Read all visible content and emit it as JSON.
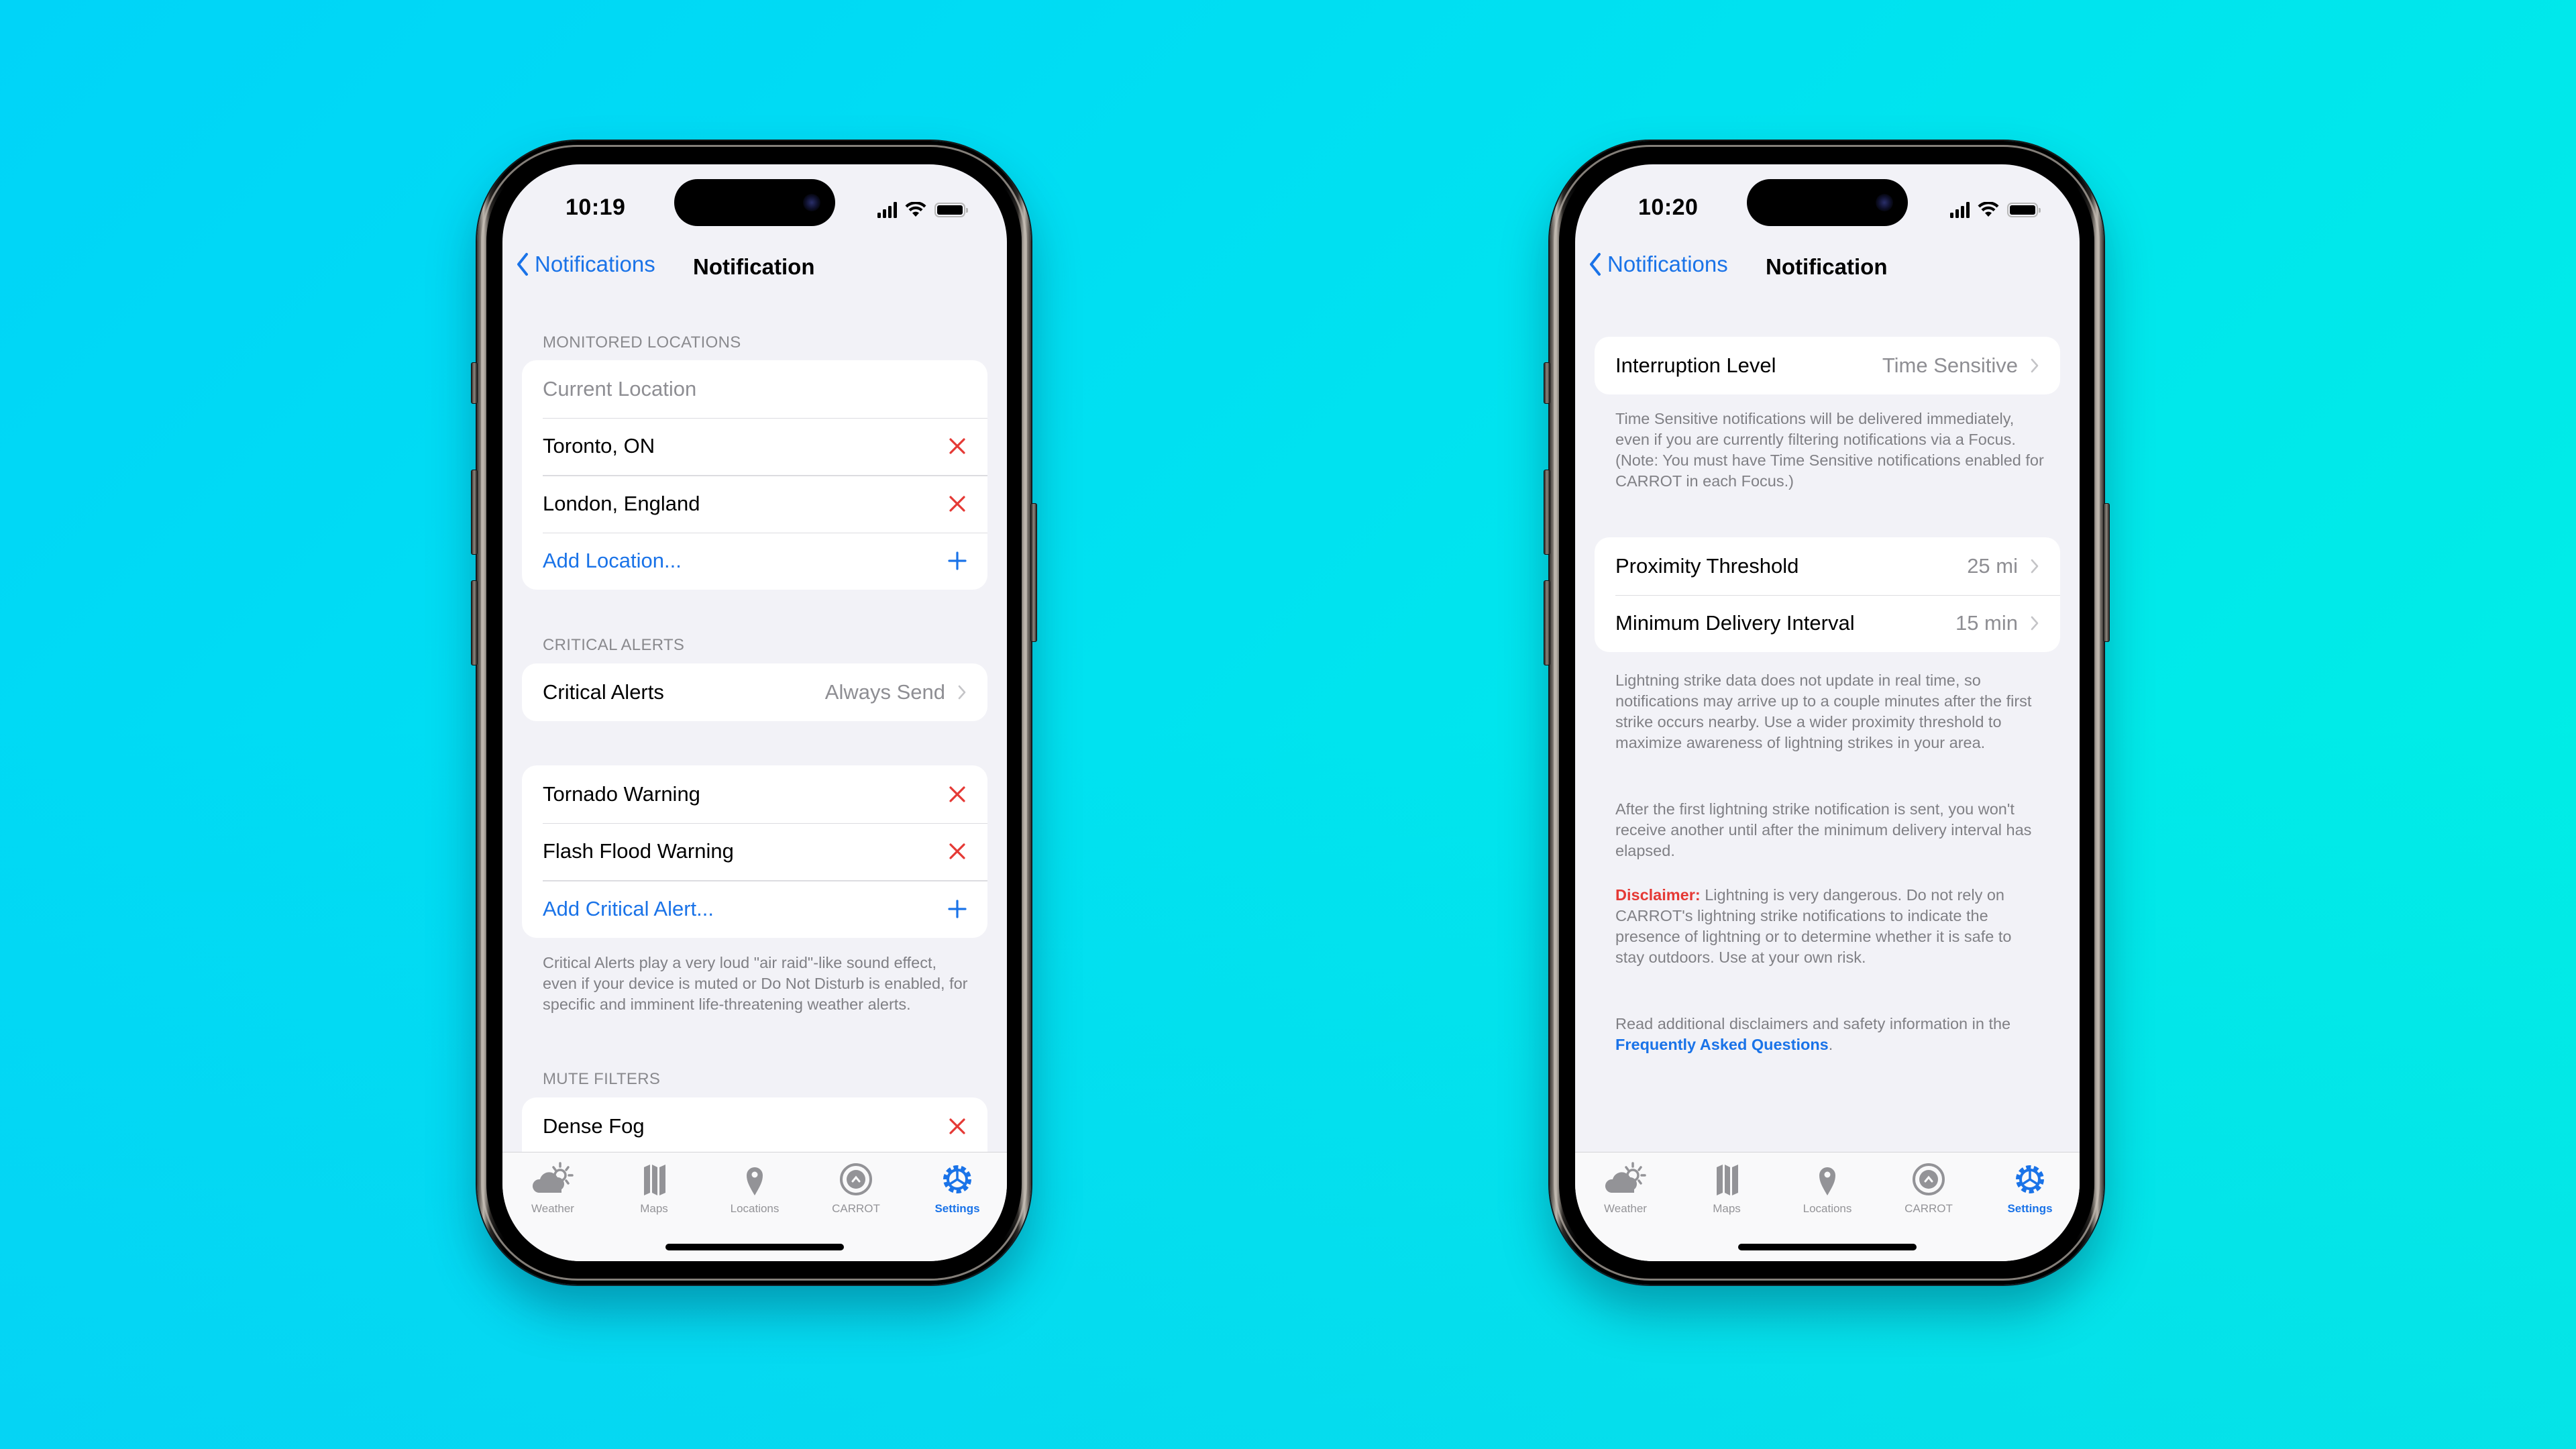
{
  "colors": {
    "accent": "#1a73e8",
    "destructive": "#e53935",
    "secondary_text": "#8e8e93",
    "grouped_background": "#f2f2f7"
  },
  "left_phone": {
    "status_bar": {
      "time": "10:19"
    },
    "nav": {
      "back_label": "Notifications",
      "title": "Notification"
    },
    "monitored_locations": {
      "header": "MONITORED LOCATIONS",
      "current_location": "Current Location",
      "items": [
        {
          "label": "Toronto, ON",
          "action_icon": "x-icon"
        },
        {
          "label": "London, England",
          "action_icon": "x-icon"
        }
      ],
      "add_label": "Add Location...",
      "add_icon": "plus-icon"
    },
    "critical_alerts": {
      "header": "CRITICAL ALERTS",
      "setting_label": "Critical Alerts",
      "setting_value": "Always Send",
      "items": [
        {
          "label": "Tornado Warning",
          "action_icon": "x-icon"
        },
        {
          "label": "Flash Flood Warning",
          "action_icon": "x-icon"
        }
      ],
      "add_label": "Add Critical Alert...",
      "footer": "Critical Alerts play a very loud \"air raid\"-like sound effect, even if your device is muted or Do Not Disturb is enabled, for specific and imminent life-threatening weather alerts."
    },
    "mute_filters": {
      "header": "MUTE FILTERS",
      "items": [
        {
          "label": "Dense Fog",
          "action_icon": "x-icon"
        }
      ]
    }
  },
  "right_phone": {
    "status_bar": {
      "time": "10:20"
    },
    "nav": {
      "back_label": "Notifications",
      "title": "Notification"
    },
    "interruption": {
      "label": "Interruption Level",
      "value": "Time Sensitive",
      "footer": "Time Sensitive notifications will be delivered immediately, even if you are currently filtering notifications via a Focus. (Note: You must have Time Sensitive notifications enabled for CARROT in each Focus.)"
    },
    "lightning": {
      "proximity_label": "Proximity Threshold",
      "proximity_value": "25 mi",
      "interval_label": "Minimum Delivery Interval",
      "interval_value": "15 min",
      "footer_1": "Lightning strike data does not update in real time, so notifications may arrive up to a couple minutes after the first strike occurs nearby. Use a wider proximity threshold to maximize awareness of lightning strikes in your area.",
      "footer_2": "After the first lightning strike notification is sent, you won't receive another until after the minimum delivery interval has elapsed.",
      "disclaimer_label": "Disclaimer:",
      "disclaimer_text": " Lightning is very dangerous. Do not rely on CARROT's lightning strike notifications to indicate the presence of lightning or to determine whether it is safe to stay outdoors. Use at your own risk.",
      "faq_prefix": "Read additional disclaimers and safety information in the ",
      "faq_link": "Frequently Asked Questions",
      "faq_suffix": "."
    }
  },
  "tabbar": {
    "items": [
      {
        "label": "Weather",
        "icon": "weather-icon",
        "active": false
      },
      {
        "label": "Maps",
        "icon": "map-icon",
        "active": false
      },
      {
        "label": "Locations",
        "icon": "location-pin-icon",
        "active": false
      },
      {
        "label": "CARROT",
        "icon": "carrot-icon",
        "active": false
      },
      {
        "label": "Settings",
        "icon": "gear-icon",
        "active": true
      }
    ]
  }
}
